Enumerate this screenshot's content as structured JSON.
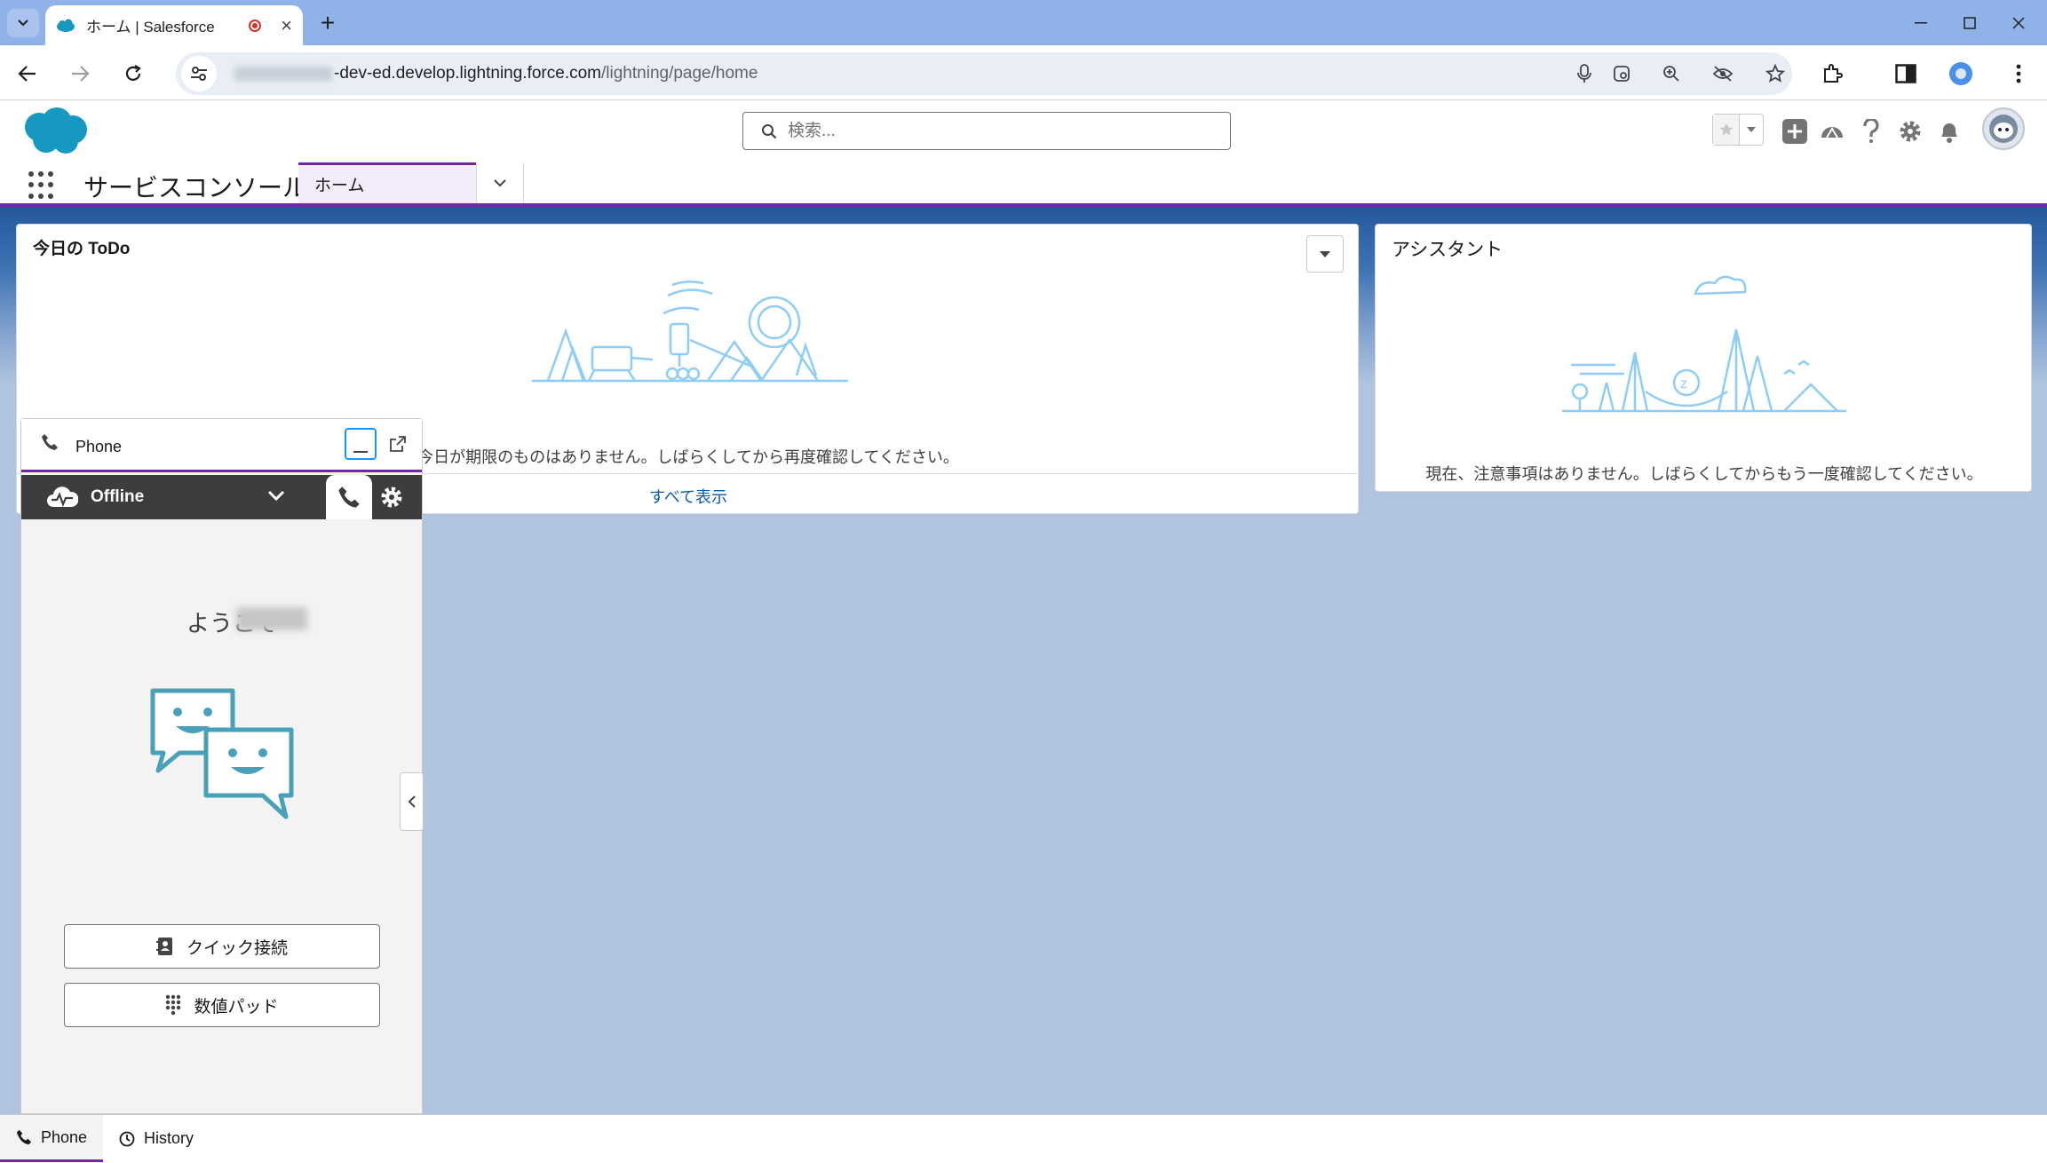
{
  "browser": {
    "tab_title": "ホーム | Salesforce",
    "url_host_suffix": "-dev-ed.develop.lightning.force.com",
    "url_path": "/lightning/page/home"
  },
  "header": {
    "search_placeholder": "検索..."
  },
  "nav": {
    "app_name": "サービスコンソール",
    "tab_label": "ホーム"
  },
  "todo": {
    "title": "今日の ToDo",
    "empty_message": "今日が期限のものはありません。しばらくしてから再度確認してください。",
    "view_all": "すべて表示"
  },
  "assistant": {
    "title": "アシスタント",
    "empty_message": "現在、注意事項はありません。しばらくしてからもう一度確認してください。"
  },
  "softphone": {
    "title": "Phone",
    "status": "Offline",
    "welcome": "ようこそ",
    "quick_connect": "クイック接続",
    "dialpad": "数値パッド"
  },
  "utility_bar": {
    "items": [
      {
        "label": "Phone",
        "icon": "phone-icon"
      },
      {
        "label": "History",
        "icon": "clock-icon"
      }
    ]
  },
  "colors": {
    "accent": "#7526a5",
    "link": "#0b5cab",
    "brand_cloud": "#1798c1",
    "illustration": "#8ecdf5",
    "chat_illustration": "#4aa0b8"
  }
}
